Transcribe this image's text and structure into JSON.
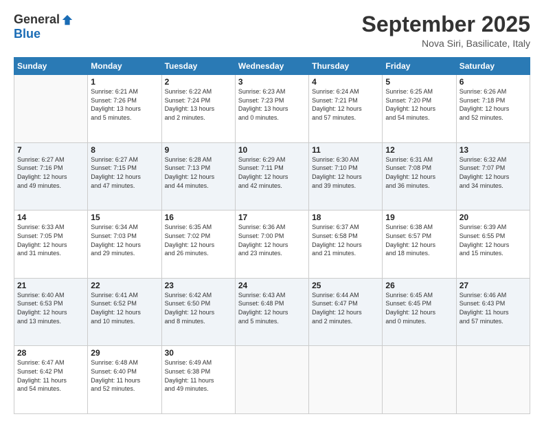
{
  "header": {
    "logo_general": "General",
    "logo_blue": "Blue",
    "month_title": "September 2025",
    "location": "Nova Siri, Basilicate, Italy"
  },
  "days_of_week": [
    "Sunday",
    "Monday",
    "Tuesday",
    "Wednesday",
    "Thursday",
    "Friday",
    "Saturday"
  ],
  "weeks": [
    [
      {
        "day": "",
        "info": ""
      },
      {
        "day": "1",
        "info": "Sunrise: 6:21 AM\nSunset: 7:26 PM\nDaylight: 13 hours\nand 5 minutes."
      },
      {
        "day": "2",
        "info": "Sunrise: 6:22 AM\nSunset: 7:24 PM\nDaylight: 13 hours\nand 2 minutes."
      },
      {
        "day": "3",
        "info": "Sunrise: 6:23 AM\nSunset: 7:23 PM\nDaylight: 13 hours\nand 0 minutes."
      },
      {
        "day": "4",
        "info": "Sunrise: 6:24 AM\nSunset: 7:21 PM\nDaylight: 12 hours\nand 57 minutes."
      },
      {
        "day": "5",
        "info": "Sunrise: 6:25 AM\nSunset: 7:20 PM\nDaylight: 12 hours\nand 54 minutes."
      },
      {
        "day": "6",
        "info": "Sunrise: 6:26 AM\nSunset: 7:18 PM\nDaylight: 12 hours\nand 52 minutes."
      }
    ],
    [
      {
        "day": "7",
        "info": "Sunrise: 6:27 AM\nSunset: 7:16 PM\nDaylight: 12 hours\nand 49 minutes."
      },
      {
        "day": "8",
        "info": "Sunrise: 6:27 AM\nSunset: 7:15 PM\nDaylight: 12 hours\nand 47 minutes."
      },
      {
        "day": "9",
        "info": "Sunrise: 6:28 AM\nSunset: 7:13 PM\nDaylight: 12 hours\nand 44 minutes."
      },
      {
        "day": "10",
        "info": "Sunrise: 6:29 AM\nSunset: 7:11 PM\nDaylight: 12 hours\nand 42 minutes."
      },
      {
        "day": "11",
        "info": "Sunrise: 6:30 AM\nSunset: 7:10 PM\nDaylight: 12 hours\nand 39 minutes."
      },
      {
        "day": "12",
        "info": "Sunrise: 6:31 AM\nSunset: 7:08 PM\nDaylight: 12 hours\nand 36 minutes."
      },
      {
        "day": "13",
        "info": "Sunrise: 6:32 AM\nSunset: 7:07 PM\nDaylight: 12 hours\nand 34 minutes."
      }
    ],
    [
      {
        "day": "14",
        "info": "Sunrise: 6:33 AM\nSunset: 7:05 PM\nDaylight: 12 hours\nand 31 minutes."
      },
      {
        "day": "15",
        "info": "Sunrise: 6:34 AM\nSunset: 7:03 PM\nDaylight: 12 hours\nand 29 minutes."
      },
      {
        "day": "16",
        "info": "Sunrise: 6:35 AM\nSunset: 7:02 PM\nDaylight: 12 hours\nand 26 minutes."
      },
      {
        "day": "17",
        "info": "Sunrise: 6:36 AM\nSunset: 7:00 PM\nDaylight: 12 hours\nand 23 minutes."
      },
      {
        "day": "18",
        "info": "Sunrise: 6:37 AM\nSunset: 6:58 PM\nDaylight: 12 hours\nand 21 minutes."
      },
      {
        "day": "19",
        "info": "Sunrise: 6:38 AM\nSunset: 6:57 PM\nDaylight: 12 hours\nand 18 minutes."
      },
      {
        "day": "20",
        "info": "Sunrise: 6:39 AM\nSunset: 6:55 PM\nDaylight: 12 hours\nand 15 minutes."
      }
    ],
    [
      {
        "day": "21",
        "info": "Sunrise: 6:40 AM\nSunset: 6:53 PM\nDaylight: 12 hours\nand 13 minutes."
      },
      {
        "day": "22",
        "info": "Sunrise: 6:41 AM\nSunset: 6:52 PM\nDaylight: 12 hours\nand 10 minutes."
      },
      {
        "day": "23",
        "info": "Sunrise: 6:42 AM\nSunset: 6:50 PM\nDaylight: 12 hours\nand 8 minutes."
      },
      {
        "day": "24",
        "info": "Sunrise: 6:43 AM\nSunset: 6:48 PM\nDaylight: 12 hours\nand 5 minutes."
      },
      {
        "day": "25",
        "info": "Sunrise: 6:44 AM\nSunset: 6:47 PM\nDaylight: 12 hours\nand 2 minutes."
      },
      {
        "day": "26",
        "info": "Sunrise: 6:45 AM\nSunset: 6:45 PM\nDaylight: 12 hours\nand 0 minutes."
      },
      {
        "day": "27",
        "info": "Sunrise: 6:46 AM\nSunset: 6:43 PM\nDaylight: 11 hours\nand 57 minutes."
      }
    ],
    [
      {
        "day": "28",
        "info": "Sunrise: 6:47 AM\nSunset: 6:42 PM\nDaylight: 11 hours\nand 54 minutes."
      },
      {
        "day": "29",
        "info": "Sunrise: 6:48 AM\nSunset: 6:40 PM\nDaylight: 11 hours\nand 52 minutes."
      },
      {
        "day": "30",
        "info": "Sunrise: 6:49 AM\nSunset: 6:38 PM\nDaylight: 11 hours\nand 49 minutes."
      },
      {
        "day": "",
        "info": ""
      },
      {
        "day": "",
        "info": ""
      },
      {
        "day": "",
        "info": ""
      },
      {
        "day": "",
        "info": ""
      }
    ]
  ]
}
